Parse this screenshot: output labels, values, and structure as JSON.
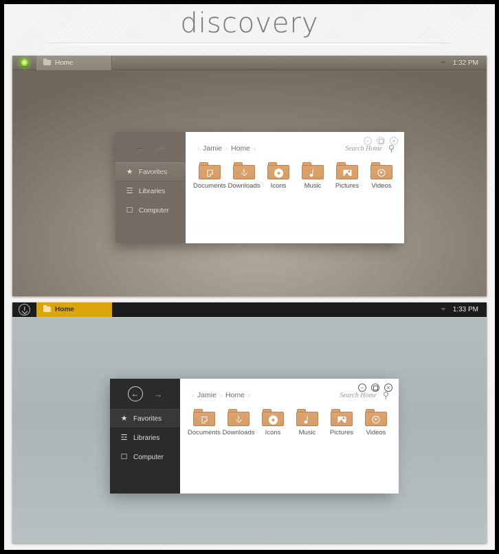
{
  "page": {
    "title": "discovery"
  },
  "shots": [
    {
      "theme": "light",
      "topbar": {
        "launcher_icon": "green-orb-icon",
        "tab": {
          "label": "Home",
          "icon": "folder-icon"
        },
        "caret_icon": "chevron-down-icon",
        "clock": "1:32 PM"
      },
      "window": {
        "nav": {
          "back_icon": "arrow-left-icon",
          "forward_icon": "arrow-right-icon",
          "back_glyph": "←",
          "forward_glyph": "→"
        },
        "sidebar": [
          {
            "label": "Favorites",
            "icon": "star-icon",
            "glyph": "★",
            "active": true
          },
          {
            "label": "Libraries",
            "icon": "bank-icon",
            "glyph": "☲",
            "active": false
          },
          {
            "label": "Computer",
            "icon": "monitor-icon",
            "glyph": "☐",
            "active": false
          }
        ],
        "controls": [
          {
            "name": "minimize-button",
            "glyph": "−"
          },
          {
            "name": "maximize-button",
            "glyph": ""
          },
          {
            "name": "close-button",
            "glyph": "×"
          }
        ],
        "breadcrumb": [
          "Jamie",
          "Home"
        ],
        "breadcrumb_separator": "›",
        "search": {
          "placeholder": "Search Home",
          "icon": "magnifier-icon"
        },
        "folders": [
          {
            "label": "Documents",
            "emblem": "document-emblem"
          },
          {
            "label": "Downloads",
            "emblem": "download-emblem"
          },
          {
            "label": "Icons",
            "emblem": "gear-emblem"
          },
          {
            "label": "Music",
            "emblem": "music-note-emblem"
          },
          {
            "label": "Pictures",
            "emblem": "picture-emblem"
          },
          {
            "label": "Videos",
            "emblem": "play-emblem"
          }
        ]
      }
    },
    {
      "theme": "dark",
      "topbar": {
        "launcher_icon": "download-circle-icon",
        "tab": {
          "label": "Home",
          "icon": "folder-icon"
        },
        "caret_icon": "chevron-down-icon",
        "clock": "1:33 PM"
      },
      "window": {
        "nav": {
          "back_icon": "arrow-left-circle-icon",
          "forward_icon": "arrow-right-icon",
          "back_glyph": "←",
          "forward_glyph": "→"
        },
        "sidebar": [
          {
            "label": "Favorites",
            "icon": "star-icon",
            "glyph": "★",
            "active": true
          },
          {
            "label": "Libraries",
            "icon": "bank-icon",
            "glyph": "☲",
            "active": false
          },
          {
            "label": "Computer",
            "icon": "monitor-icon",
            "glyph": "☐",
            "active": false
          }
        ],
        "controls": [
          {
            "name": "minimize-button",
            "glyph": "−"
          },
          {
            "name": "maximize-button",
            "glyph": ""
          },
          {
            "name": "close-button",
            "glyph": "×"
          }
        ],
        "breadcrumb": [
          "Jamie",
          "Home"
        ],
        "breadcrumb_separator": "›",
        "search": {
          "placeholder": "Search Home",
          "icon": "magnifier-icon"
        },
        "folders": [
          {
            "label": "Documents",
            "emblem": "document-emblem"
          },
          {
            "label": "Downloads",
            "emblem": "download-emblem"
          },
          {
            "label": "Icons",
            "emblem": "gear-emblem"
          },
          {
            "label": "Music",
            "emblem": "music-note-emblem"
          },
          {
            "label": "Pictures",
            "emblem": "picture-emblem"
          },
          {
            "label": "Videos",
            "emblem": "play-emblem"
          }
        ]
      }
    }
  ],
  "colors": {
    "accent_light_tab": "#9a9387",
    "accent_dark_tab": "#d9a508",
    "folder": "#d69d67",
    "desktop_light": "#9b9184",
    "desktop_dark": "#b3bdbd",
    "launcher_green": "#8ce03c"
  }
}
